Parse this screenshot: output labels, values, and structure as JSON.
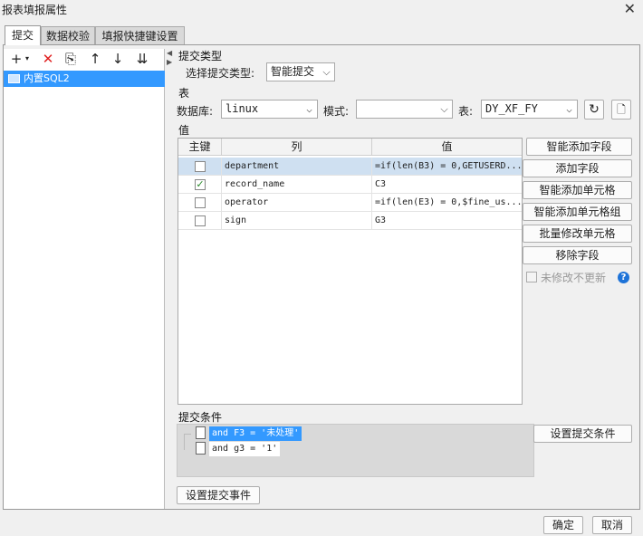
{
  "window": {
    "title": "报表填报属性",
    "close": "✕"
  },
  "tabs": [
    {
      "label": "提交"
    },
    {
      "label": "数据校验"
    },
    {
      "label": "填报快捷键设置"
    }
  ],
  "left": {
    "toolbar": {
      "add": "+",
      "add_caret": "▾",
      "delete": "✕",
      "copy": "⎘",
      "up": "↑",
      "down": "↓",
      "bottom": "⇊"
    },
    "tree": [
      {
        "label": "内置SQL2"
      }
    ]
  },
  "submit_type": {
    "section": "提交类型",
    "label": "选择提交类型:",
    "value": "智能提交"
  },
  "table_section": {
    "section": "表",
    "db_label": "数据库:",
    "db_value": "linux",
    "schema_label": "模式:",
    "schema_value": "",
    "table_label": "表:",
    "table_value": "DY_XF_FY"
  },
  "value_section": {
    "section": "值",
    "headers": {
      "key": "主键",
      "column": "列",
      "value": "值"
    },
    "rows": [
      {
        "key": false,
        "column": "department",
        "value": "=if(len(B3) = 0,GETUSERD..."
      },
      {
        "key": true,
        "column": "record_name",
        "value": "C3"
      },
      {
        "key": false,
        "column": "operator",
        "value": "=if(len(E3) = 0,$fine_us..."
      },
      {
        "key": false,
        "column": "sign",
        "value": "G3"
      }
    ],
    "check_mark": "✓"
  },
  "side_buttons": {
    "smart_add_field": "智能添加字段",
    "add_field": "添加字段",
    "smart_add_cell": "智能添加单元格",
    "smart_add_cell_group": "智能添加单元格组",
    "batch_modify_cell": "批量修改单元格",
    "remove_field": "移除字段",
    "no_update_label": "未修改不更新",
    "help": "?"
  },
  "conditions": {
    "section": "提交条件",
    "items": [
      {
        "text": "and F3 = '未处理'"
      },
      {
        "text": "and g3 = '1'"
      }
    ],
    "set_button": "设置提交条件"
  },
  "event_button": "设置提交事件",
  "footer": {
    "ok": "确定",
    "cancel": "取消"
  }
}
